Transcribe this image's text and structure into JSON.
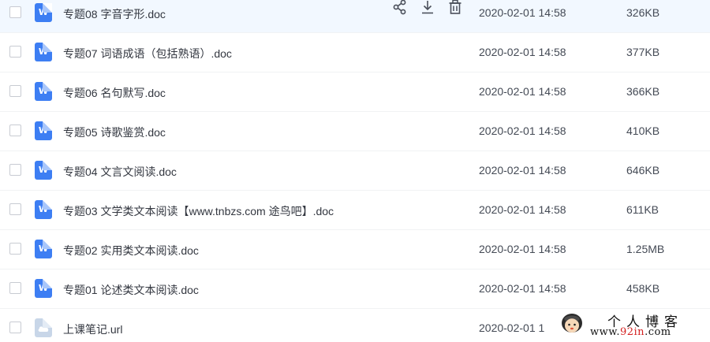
{
  "files": [
    {
      "name": "专题08 字音字形.doc",
      "date": "2020-02-01 14:58",
      "size": "326KB",
      "type": "word"
    },
    {
      "name": "专题07 词语成语（包括熟语）.doc",
      "date": "2020-02-01 14:58",
      "size": "377KB",
      "type": "word"
    },
    {
      "name": "专题06 名句默写.doc",
      "date": "2020-02-01 14:58",
      "size": "366KB",
      "type": "word"
    },
    {
      "name": "专题05 诗歌鉴赏.doc",
      "date": "2020-02-01 14:58",
      "size": "410KB",
      "type": "word"
    },
    {
      "name": "专题04 文言文阅读.doc",
      "date": "2020-02-01 14:58",
      "size": "646KB",
      "type": "word"
    },
    {
      "name": "专题03 文学类文本阅读【www.tnbzs.com 途鸟吧】.doc",
      "date": "2020-02-01 14:58",
      "size": "611KB",
      "type": "word"
    },
    {
      "name": "专题02 实用类文本阅读.doc",
      "date": "2020-02-01 14:58",
      "size": "1.25MB",
      "type": "word"
    },
    {
      "name": "专题01 论述类文本阅读.doc",
      "date": "2020-02-01 14:58",
      "size": "458KB",
      "type": "word"
    },
    {
      "name": "上课笔记.url",
      "date": "2020-02-01 1",
      "size": "",
      "type": "link"
    }
  ],
  "word_icon_glyph": "W",
  "hover_actions": [
    "share-icon",
    "download-icon",
    "delete-icon"
  ],
  "watermark": {
    "title": "个人博客",
    "url_prefix": "www.",
    "url_red": "92in",
    "url_suffix": ".com"
  },
  "colors": {
    "word_icon": "#3d7ef3",
    "hover_row": "#f2f8ff",
    "watermark_red": "#d41f1f"
  }
}
